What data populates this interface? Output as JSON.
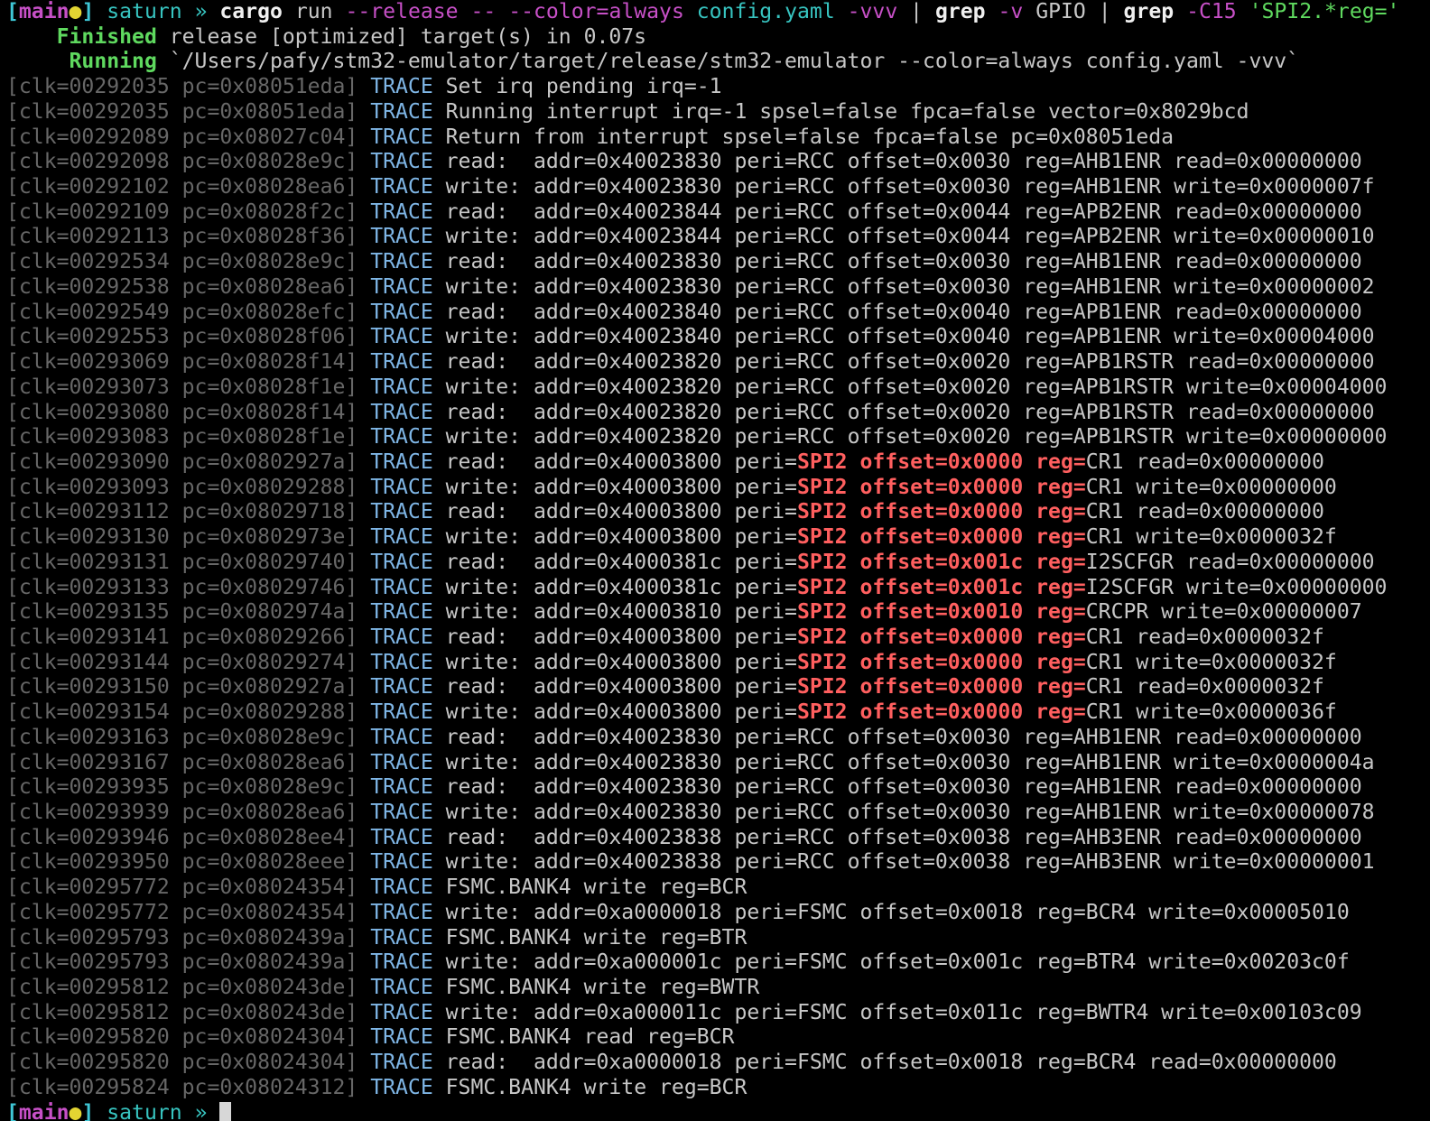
{
  "prompt": [
    {
      "text": "[",
      "cls": "t-cyan t-bold"
    },
    {
      "text": "main",
      "cls": "t-magenta t-bold"
    },
    {
      "text": "●",
      "cls": "t-yellow"
    },
    {
      "text": "]",
      "cls": "t-cyan t-bold"
    },
    {
      "text": " saturn » ",
      "cls": "t-teal"
    },
    {
      "text": "cargo",
      "cls": "t-white t-bold"
    },
    {
      "text": " run ",
      "cls": "t-grey"
    },
    {
      "text": "--release",
      "cls": "t-magenta"
    },
    {
      "text": " ",
      "cls": "t-grey"
    },
    {
      "text": "--",
      "cls": "t-magenta"
    },
    {
      "text": " ",
      "cls": "t-grey"
    },
    {
      "text": "--color=always",
      "cls": "t-magenta"
    },
    {
      "text": " config.yaml ",
      "cls": "t-teal"
    },
    {
      "text": "-vvv",
      "cls": "t-magenta"
    },
    {
      "text": " | ",
      "cls": "t-grey"
    },
    {
      "text": "grep",
      "cls": "t-white t-bold"
    },
    {
      "text": " ",
      "cls": "t-grey"
    },
    {
      "text": "-v",
      "cls": "t-magenta"
    },
    {
      "text": " GPIO | ",
      "cls": "t-grey"
    },
    {
      "text": "grep",
      "cls": "t-white t-bold"
    },
    {
      "text": " ",
      "cls": "t-grey"
    },
    {
      "text": "-C15",
      "cls": "t-magenta"
    },
    {
      "text": " ",
      "cls": "t-grey"
    },
    {
      "text": "'SPI2.*reg='",
      "cls": "t-green"
    }
  ],
  "status_lines": [
    {
      "label": "    Finished",
      "text": " release [optimized] target(s) in 0.07s"
    },
    {
      "label": "     Running",
      "text": " `/Users/pafy/stm32-emulator/target/release/stm32-emulator --color=always config.yaml -vvv`"
    }
  ],
  "trace_level": "TRACE",
  "log_lines": [
    {
      "prefix": "[clk=00292035 pc=0x08051eda]",
      "msg": "Set irq pending irq=-1"
    },
    {
      "prefix": "[clk=00292035 pc=0x08051eda]",
      "msg": "Running interrupt irq=-1 spsel=false fpca=false vector=0x8029bcd"
    },
    {
      "prefix": "[clk=00292089 pc=0x08027c04]",
      "msg": "Return from interrupt spsel=false fpca=false pc=0x08051eda"
    },
    {
      "prefix": "[clk=00292098 pc=0x08028e9c]",
      "msg": "read:  addr=0x40023830 peri=RCC offset=0x0030 reg=AHB1ENR read=0x00000000"
    },
    {
      "prefix": "[clk=00292102 pc=0x08028ea6]",
      "msg": "write: addr=0x40023830 peri=RCC offset=0x0030 reg=AHB1ENR write=0x0000007f"
    },
    {
      "prefix": "[clk=00292109 pc=0x08028f2c]",
      "msg": "read:  addr=0x40023844 peri=RCC offset=0x0044 reg=APB2ENR read=0x00000000"
    },
    {
      "prefix": "[clk=00292113 pc=0x08028f36]",
      "msg": "write: addr=0x40023844 peri=RCC offset=0x0044 reg=APB2ENR write=0x00000010"
    },
    {
      "prefix": "[clk=00292534 pc=0x08028e9c]",
      "msg": "read:  addr=0x40023830 peri=RCC offset=0x0030 reg=AHB1ENR read=0x00000000"
    },
    {
      "prefix": "[clk=00292538 pc=0x08028ea6]",
      "msg": "write: addr=0x40023830 peri=RCC offset=0x0030 reg=AHB1ENR write=0x00000002"
    },
    {
      "prefix": "[clk=00292549 pc=0x08028efc]",
      "msg": "read:  addr=0x40023840 peri=RCC offset=0x0040 reg=APB1ENR read=0x00000000"
    },
    {
      "prefix": "[clk=00292553 pc=0x08028f06]",
      "msg": "write: addr=0x40023840 peri=RCC offset=0x0040 reg=APB1ENR write=0x00004000"
    },
    {
      "prefix": "[clk=00293069 pc=0x08028f14]",
      "msg": "read:  addr=0x40023820 peri=RCC offset=0x0020 reg=APB1RSTR read=0x00000000"
    },
    {
      "prefix": "[clk=00293073 pc=0x08028f1e]",
      "msg": "write: addr=0x40023820 peri=RCC offset=0x0020 reg=APB1RSTR write=0x00004000"
    },
    {
      "prefix": "[clk=00293080 pc=0x08028f14]",
      "msg": "read:  addr=0x40023820 peri=RCC offset=0x0020 reg=APB1RSTR read=0x00000000"
    },
    {
      "prefix": "[clk=00293083 pc=0x08028f1e]",
      "msg": "write: addr=0x40023820 peri=RCC offset=0x0020 reg=APB1RSTR write=0x00000000"
    },
    {
      "prefix": "[clk=00293090 pc=0x0802927a]",
      "msg": "read:  addr=0x40003800 peri=",
      "hl": "SPI2 offset=0x0000 reg=",
      "rest": "CR1 read=0x00000000"
    },
    {
      "prefix": "[clk=00293093 pc=0x08029288]",
      "msg": "write: addr=0x40003800 peri=",
      "hl": "SPI2 offset=0x0000 reg=",
      "rest": "CR1 write=0x00000000"
    },
    {
      "prefix": "[clk=00293112 pc=0x08029718]",
      "msg": "read:  addr=0x40003800 peri=",
      "hl": "SPI2 offset=0x0000 reg=",
      "rest": "CR1 read=0x00000000"
    },
    {
      "prefix": "[clk=00293130 pc=0x0802973e]",
      "msg": "write: addr=0x40003800 peri=",
      "hl": "SPI2 offset=0x0000 reg=",
      "rest": "CR1 write=0x0000032f"
    },
    {
      "prefix": "[clk=00293131 pc=0x08029740]",
      "msg": "read:  addr=0x4000381c peri=",
      "hl": "SPI2 offset=0x001c reg=",
      "rest": "I2SCFGR read=0x00000000"
    },
    {
      "prefix": "[clk=00293133 pc=0x08029746]",
      "msg": "write: addr=0x4000381c peri=",
      "hl": "SPI2 offset=0x001c reg=",
      "rest": "I2SCFGR write=0x00000000"
    },
    {
      "prefix": "[clk=00293135 pc=0x0802974a]",
      "msg": "write: addr=0x40003810 peri=",
      "hl": "SPI2 offset=0x0010 reg=",
      "rest": "CRCPR write=0x00000007"
    },
    {
      "prefix": "[clk=00293141 pc=0x08029266]",
      "msg": "read:  addr=0x40003800 peri=",
      "hl": "SPI2 offset=0x0000 reg=",
      "rest": "CR1 read=0x0000032f"
    },
    {
      "prefix": "[clk=00293144 pc=0x08029274]",
      "msg": "write: addr=0x40003800 peri=",
      "hl": "SPI2 offset=0x0000 reg=",
      "rest": "CR1 write=0x0000032f"
    },
    {
      "prefix": "[clk=00293150 pc=0x0802927a]",
      "msg": "read:  addr=0x40003800 peri=",
      "hl": "SPI2 offset=0x0000 reg=",
      "rest": "CR1 read=0x0000032f"
    },
    {
      "prefix": "[clk=00293154 pc=0x08029288]",
      "msg": "write: addr=0x40003800 peri=",
      "hl": "SPI2 offset=0x0000 reg=",
      "rest": "CR1 write=0x0000036f"
    },
    {
      "prefix": "[clk=00293163 pc=0x08028e9c]",
      "msg": "read:  addr=0x40023830 peri=RCC offset=0x0030 reg=AHB1ENR read=0x00000000"
    },
    {
      "prefix": "[clk=00293167 pc=0x08028ea6]",
      "msg": "write: addr=0x40023830 peri=RCC offset=0x0030 reg=AHB1ENR write=0x0000004a"
    },
    {
      "prefix": "[clk=00293935 pc=0x08028e9c]",
      "msg": "read:  addr=0x40023830 peri=RCC offset=0x0030 reg=AHB1ENR read=0x00000000"
    },
    {
      "prefix": "[clk=00293939 pc=0x08028ea6]",
      "msg": "write: addr=0x40023830 peri=RCC offset=0x0030 reg=AHB1ENR write=0x00000078"
    },
    {
      "prefix": "[clk=00293946 pc=0x08028ee4]",
      "msg": "read:  addr=0x40023838 peri=RCC offset=0x0038 reg=AHB3ENR read=0x00000000"
    },
    {
      "prefix": "[clk=00293950 pc=0x08028eee]",
      "msg": "write: addr=0x40023838 peri=RCC offset=0x0038 reg=AHB3ENR write=0x00000001"
    },
    {
      "prefix": "[clk=00295772 pc=0x08024354]",
      "msg": "FSMC.BANK4 write reg=BCR"
    },
    {
      "prefix": "[clk=00295772 pc=0x08024354]",
      "msg": "write: addr=0xa0000018 peri=FSMC offset=0x0018 reg=BCR4 write=0x00005010"
    },
    {
      "prefix": "[clk=00295793 pc=0x0802439a]",
      "msg": "FSMC.BANK4 write reg=BTR"
    },
    {
      "prefix": "[clk=00295793 pc=0x0802439a]",
      "msg": "write: addr=0xa000001c peri=FSMC offset=0x001c reg=BTR4 write=0x00203c0f"
    },
    {
      "prefix": "[clk=00295812 pc=0x080243de]",
      "msg": "FSMC.BANK4 write reg=BWTR"
    },
    {
      "prefix": "[clk=00295812 pc=0x080243de]",
      "msg": "write: addr=0xa000011c peri=FSMC offset=0x011c reg=BWTR4 write=0x00103c09"
    },
    {
      "prefix": "[clk=00295820 pc=0x08024304]",
      "msg": "FSMC.BANK4 read reg=BCR"
    },
    {
      "prefix": "[clk=00295820 pc=0x08024304]",
      "msg": "read:  addr=0xa0000018 peri=FSMC offset=0x0018 reg=BCR4 read=0x00000000"
    },
    {
      "prefix": "[clk=00295824 pc=0x08024312]",
      "msg": "FSMC.BANK4 write reg=BCR"
    }
  ],
  "next_prompt": [
    {
      "text": "[",
      "cls": "t-cyan t-bold"
    },
    {
      "text": "main",
      "cls": "t-magenta t-bold"
    },
    {
      "text": "●",
      "cls": "t-yellow"
    },
    {
      "text": "]",
      "cls": "t-cyan t-bold"
    },
    {
      "text": " saturn » ",
      "cls": "t-teal"
    }
  ],
  "colors": {
    "background": "#000000",
    "trace": "#7fb6e6",
    "highlight": "#ff5f5f",
    "status_label": "#5fd95f",
    "dim_prefix": "#676767"
  }
}
